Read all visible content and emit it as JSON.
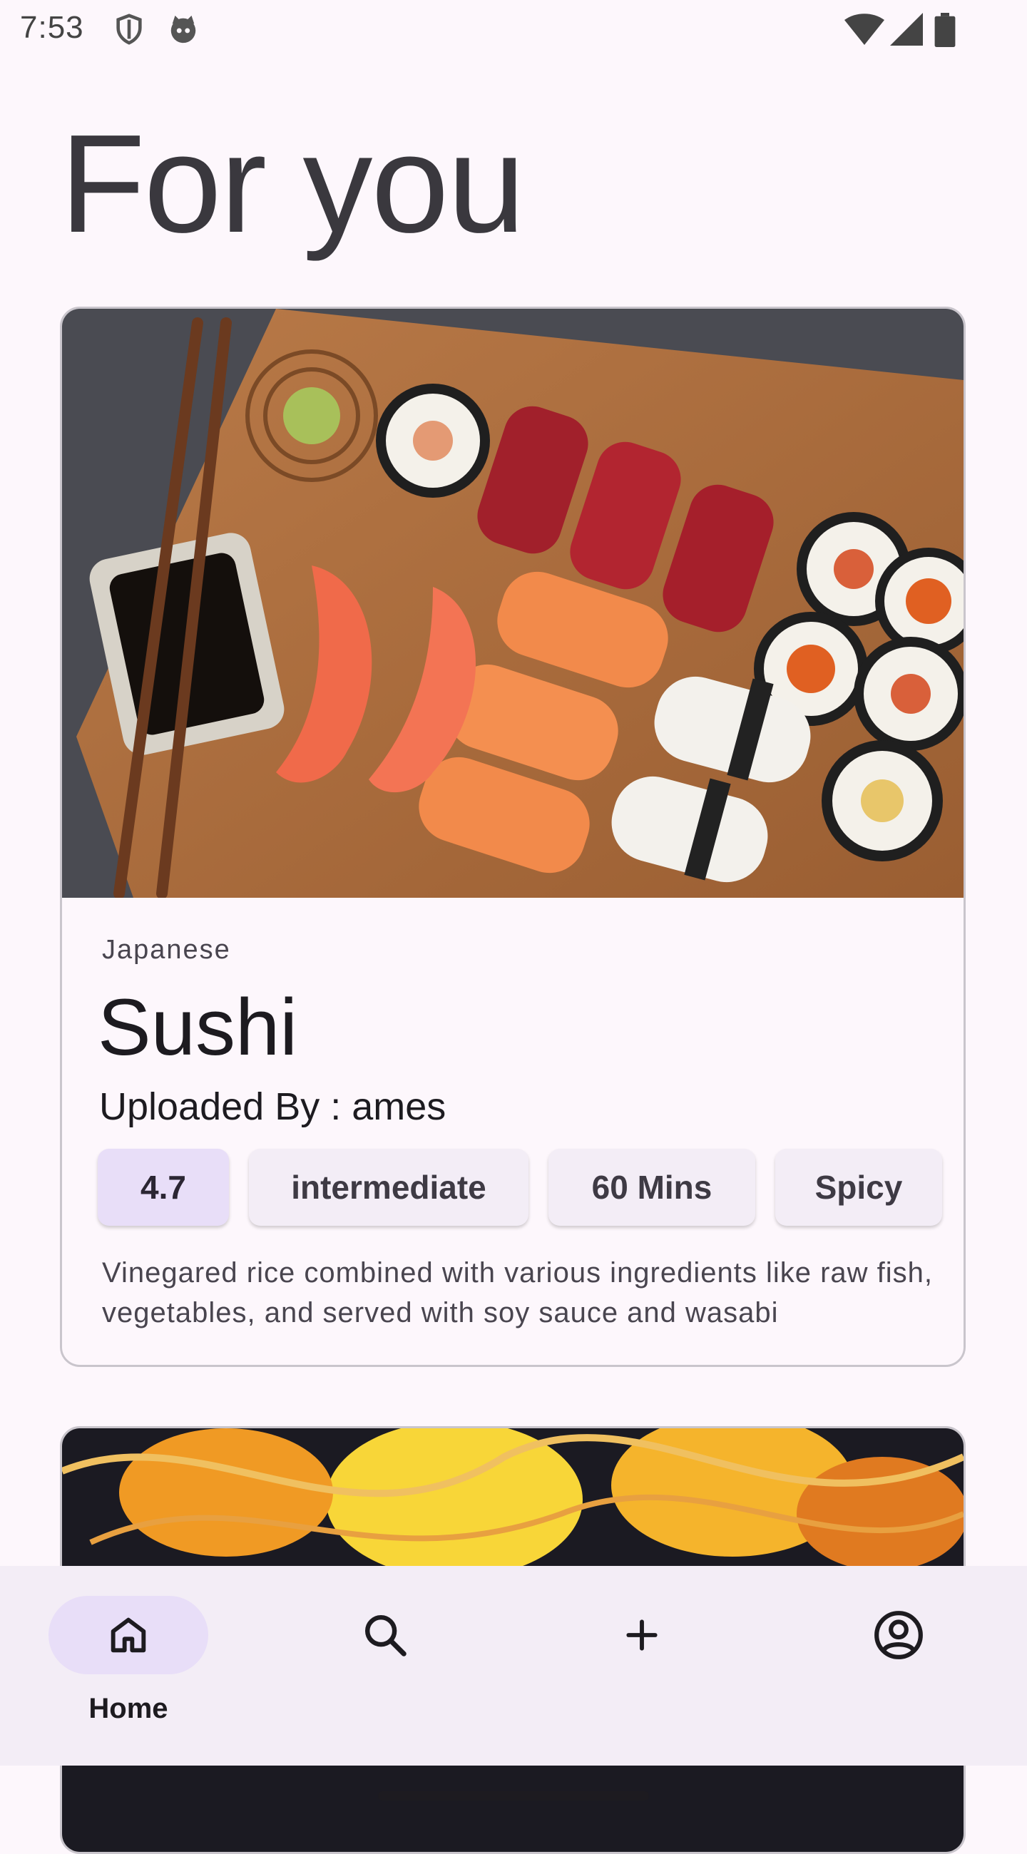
{
  "status_bar": {
    "time": "7:53",
    "icons": [
      "shield-icon",
      "cat-icon",
      "wifi-icon",
      "signal-icon",
      "battery-icon"
    ]
  },
  "page": {
    "title": "For you"
  },
  "recipes": [
    {
      "cuisine": "Japanese",
      "title": "Sushi",
      "uploader": "Uploaded By : ames",
      "rating": "4.7",
      "difficulty": "intermediate",
      "duration": "60 Mins",
      "flavor": "Spicy",
      "description": "Vinegared rice combined with various ingredients like raw fish, vegetables, and served with soy sauce and wasabi",
      "image": "sushi-platter-photo"
    },
    {
      "image": "flame-photo"
    }
  ],
  "bottom_nav": {
    "items": [
      {
        "label": "Home",
        "icon": "home-icon",
        "active": true
      },
      {
        "label": "",
        "icon": "search-icon",
        "active": false
      },
      {
        "label": "",
        "icon": "plus-icon",
        "active": false
      },
      {
        "label": "",
        "icon": "account-icon",
        "active": false
      }
    ]
  },
  "colors": {
    "background": "#fdf7fc",
    "nav_background": "#f3edf6",
    "accent_container": "#e8def8",
    "chip_background": "#f3edf6",
    "card_border": "#c9c5cc"
  }
}
